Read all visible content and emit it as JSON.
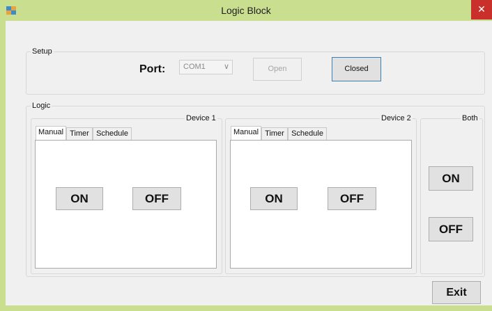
{
  "window": {
    "title": "Logic Block",
    "close_label": "✕"
  },
  "setup": {
    "group_label": "Setup",
    "port_label": "Port:",
    "port_value": "COM1",
    "open_label": "Open",
    "closed_label": "Closed"
  },
  "logic": {
    "group_label": "Logic",
    "device1": {
      "title": "Device 1",
      "tabs": [
        "Manual",
        "Timer",
        "Schedule"
      ],
      "on_label": "ON",
      "off_label": "OFF"
    },
    "device2": {
      "title": "Device 2",
      "tabs": [
        "Manual",
        "Timer",
        "Schedule"
      ],
      "on_label": "ON",
      "off_label": "OFF"
    },
    "both": {
      "title": "Both",
      "on_label": "ON",
      "off_label": "OFF"
    }
  },
  "exit_label": "Exit",
  "icons": {
    "app": "app-window-icon",
    "close": "close-icon",
    "dropdown": "chevron-down-icon"
  }
}
